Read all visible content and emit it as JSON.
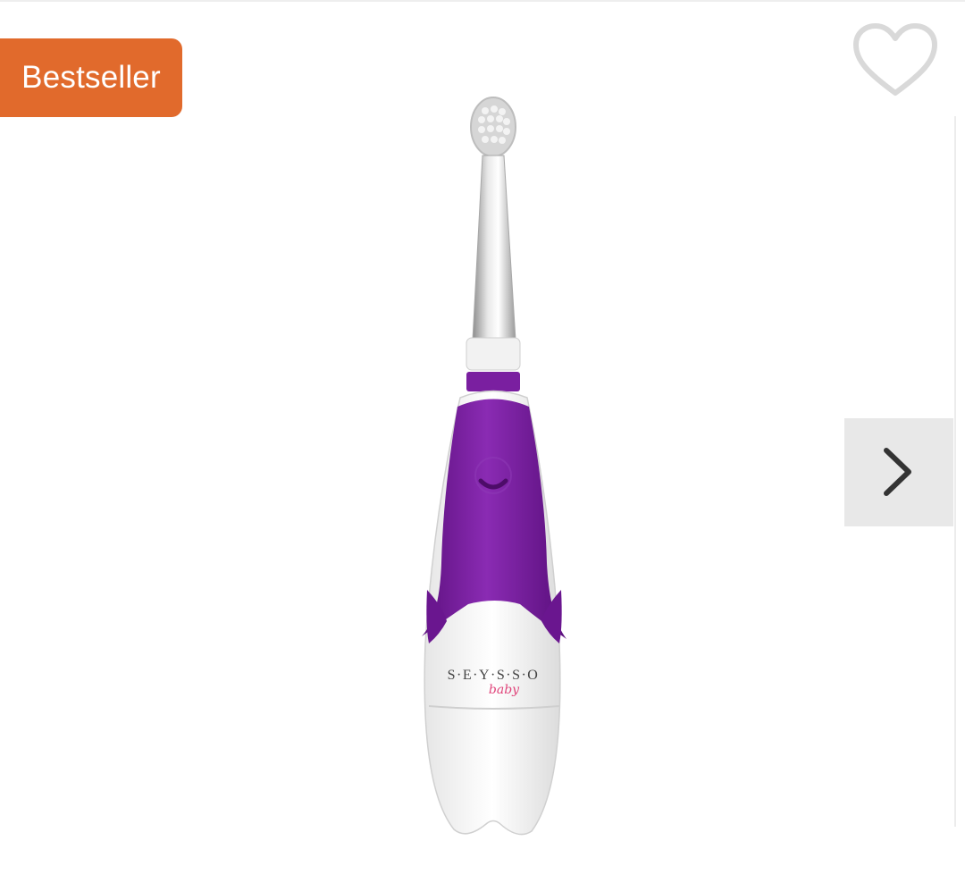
{
  "badge": {
    "label": "Bestseller",
    "color": "#e16a2c"
  },
  "wishlist": {
    "icon": "heart-outline-icon",
    "color": "#d9d9d9"
  },
  "carousel": {
    "next_icon": "chevron-right-icon",
    "next_bg": "#e8e8e8"
  },
  "product": {
    "image_icon": "electric-toothbrush",
    "brand": "S·E·Y·S·S·O",
    "sub_brand": "baby",
    "accent_color": "#7a1fa0"
  }
}
